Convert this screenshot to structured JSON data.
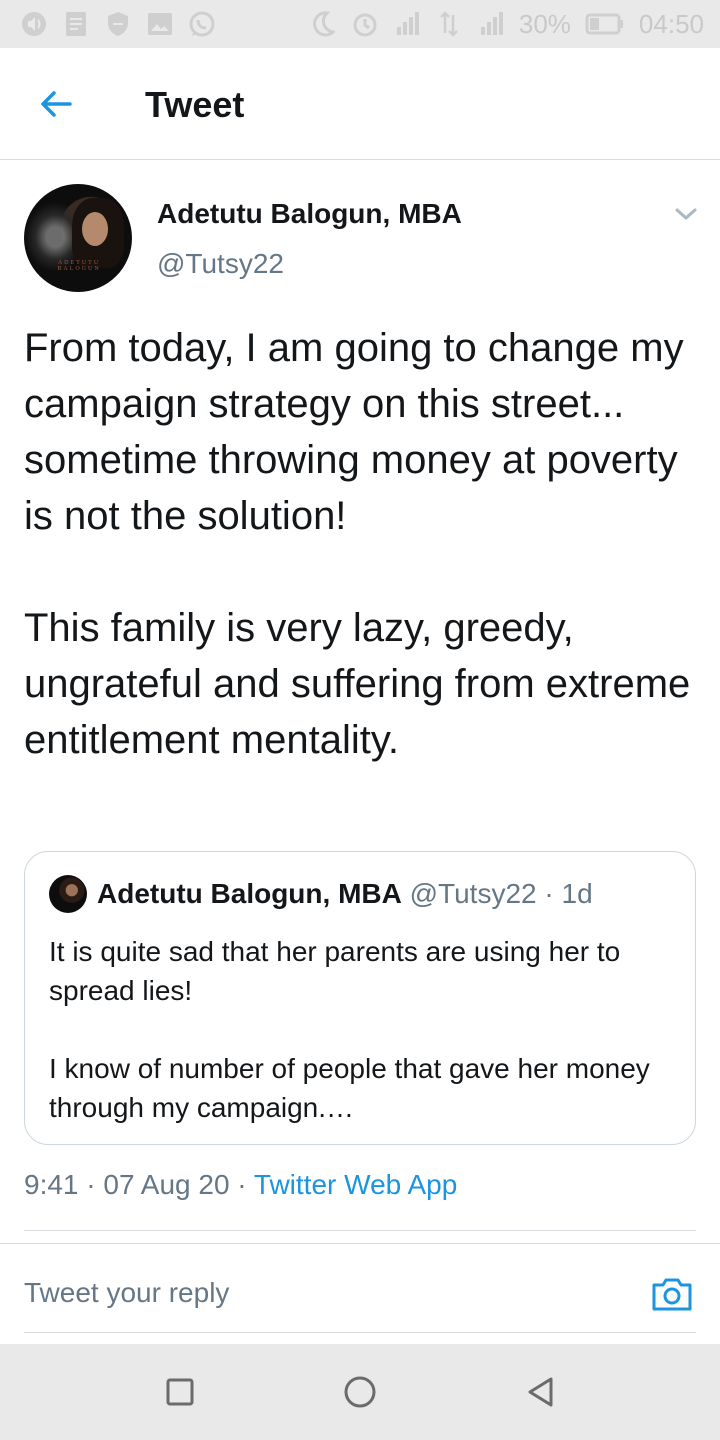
{
  "status_bar": {
    "battery": "30%",
    "time": "04:50",
    "icons": [
      "volume-icon",
      "notes-icon",
      "shield-icon",
      "image-icon",
      "whatsapp-icon",
      "moon-icon",
      "alarm-icon",
      "signal-icon",
      "data-arrows-icon",
      "signal-icon",
      "battery-icon"
    ]
  },
  "header": {
    "title": "Tweet",
    "back_icon": "back-arrow-icon"
  },
  "tweet": {
    "author_name": "Adetutu Balogun, MBA",
    "author_handle": "@Tutsy22",
    "avatar_caption": "ADETUTU BALOGUN",
    "paragraphs": [
      "From today, I am going to change my campaign strategy on this street... sometime throwing money at poverty is not the solution!",
      "This family is very lazy, greedy, ungrateful and suffering from extreme entitlement mentality."
    ],
    "time": "9:41",
    "date": "07 Aug 20",
    "source": "Twitter Web App"
  },
  "quoted_tweet": {
    "author_name": "Adetutu Balogun, MBA",
    "author_handle": "@Tutsy22",
    "age": "1d",
    "paragraphs": [
      "It is quite sad that her parents are using her to spread lies!",
      "I know of number of people that gave her money through my campaign.…"
    ]
  },
  "reply": {
    "placeholder": "Tweet your reply"
  },
  "colors": {
    "accent": "#1b95e0",
    "text": "#14171a",
    "secondary_text": "#657786",
    "border": "#ccd6dd",
    "system_bar": "#e9e9e9"
  }
}
